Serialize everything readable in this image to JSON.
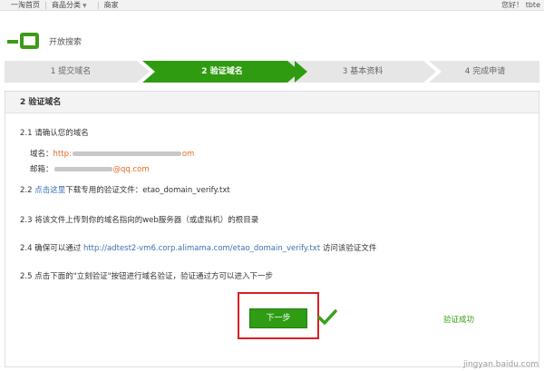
{
  "topnav": {
    "home": "一淘首页",
    "category": "商品分类",
    "merchant": "商家",
    "user_greeting": "您好！ tbte"
  },
  "brand": {
    "subtitle": "开放搜索"
  },
  "steps": [
    {
      "label": "1 提交域名",
      "state": "done"
    },
    {
      "label": "2 验证域名",
      "state": "active"
    },
    {
      "label": "3 基本资料",
      "state": "todo"
    },
    {
      "label": "4 完成申请",
      "state": "todo"
    }
  ],
  "panel": {
    "title": "2 验证域名",
    "s21": "2.1 请确认您的域名",
    "domain_label": "域名：",
    "domain_prefix": "http:",
    "domain_suffix": "om",
    "email_label": "邮箱：",
    "email_suffix": "@qq.com",
    "s22_pre": "2.2 ",
    "s22_link": "点击这里",
    "s22_post": "下载专用的验证文件：etao_domain_verify.txt",
    "s23": "2.3 将该文件上传到你的域名指向的web服务器（或虚拟机）的根目录",
    "s24_pre": "2.4 确保可以通过 ",
    "s24_link": "http://adtest2-vm6.corp.alimama.com/etao_domain_verify.txt",
    "s24_post": " 访问该验证文件",
    "s25": "2.5 点击下面的\"立刻验证\"按钮进行域名验证，验证通过方可以进入下一步",
    "next_button": "下一步",
    "verify_status": "验证成功"
  },
  "watermark": "jingyan.baidu.com",
  "colors": {
    "brand_green": "#2f9b10",
    "link_blue": "#3a6fb4",
    "highlight_red": "#d81f26",
    "orange": "#e46b1f"
  }
}
